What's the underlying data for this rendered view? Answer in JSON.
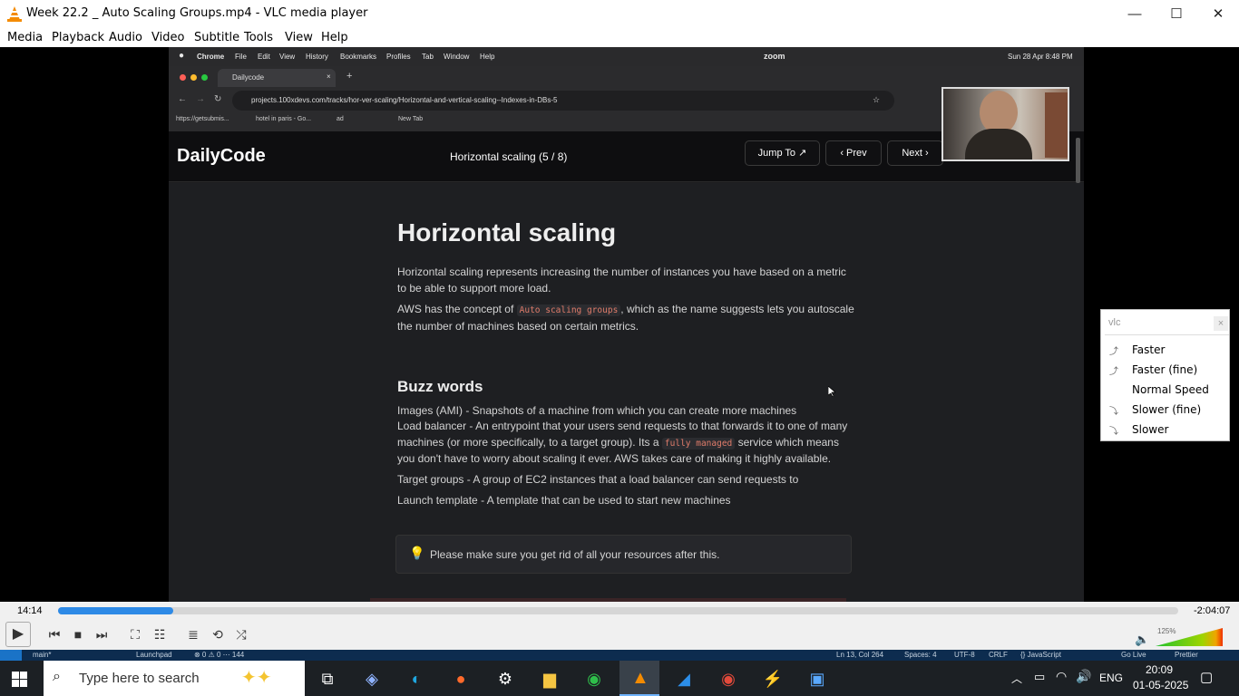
{
  "window": {
    "title": "Week 22.2 _ Auto Scaling Groups.mp4 - VLC media player",
    "minimize": "—",
    "maximize": "☐",
    "close": "✕"
  },
  "menu": [
    "Media",
    "Playback",
    "Audio",
    "Video",
    "Subtitle",
    "Tools",
    "View",
    "Help"
  ],
  "mac_menubar": {
    "apple": "",
    "app": "Chrome",
    "items": [
      "File",
      "Edit",
      "View",
      "History",
      "Bookmarks",
      "Profiles",
      "Tab",
      "Window",
      "Help"
    ],
    "zoom": "zoom",
    "clock": "Sun 28 Apr  8:48 PM"
  },
  "browser": {
    "tab_title": "Dailycode",
    "url": "projects.100xdevs.com/tracks/hor-ver-scaling/Horizontal-and-vertical-scaling--Indexes-in-DBs-5",
    "bookmarks": [
      "https://getsubmis...",
      "hotel in paris - Go...",
      "ad",
      "New Tab"
    ]
  },
  "site": {
    "logo": "DailyCode",
    "page_title": "Horizontal scaling (5 / 8)",
    "jump_to": "Jump To",
    "jump_icon": "↗",
    "prev": "Prev",
    "prev_icon": "‹",
    "next": "Next",
    "next_icon": "›"
  },
  "article": {
    "h1": "Horizontal scaling",
    "p1": "Horizontal scaling represents increasing the number of instances you have based on a metric to be able to support more load.",
    "p2_before": "AWS has the concept of ",
    "p2_code": "Auto scaling groups",
    "p2_after": ", which as the name suggests lets you autoscale the number of machines based on certain metrics.",
    "h2": "Buzz words",
    "b1": "Images (AMI) - Snapshots of a machine from which you can create more machines",
    "b2_before": "Load balancer - An entrypoint that your users send requests to that forwards it to one of many machines (or more specifically, to a target group). Its a ",
    "b2_code": "fully managed",
    "b2_after": " service which means you don't have to worry about scaling it ever. AWS takes care of making it highly available.",
    "b3": "Target groups - A group of EC2 instances that a load balancer can send requests to",
    "b4": "Launch template - A template that can be used to start new machines",
    "callout": "Please make sure you get rid of all your resources after this."
  },
  "popup": {
    "input_value": "vlc",
    "close": "×",
    "items": [
      "Faster",
      "Faster (fine)",
      "Normal Speed",
      "Slower (fine)",
      "Slower"
    ]
  },
  "player": {
    "elapsed": "14:14",
    "remaining": "-2:04:07",
    "progress": 0.1025,
    "volume_label": "125%",
    "volume": 1.0
  },
  "vscode_strip": {
    "left": "main*",
    "launchpad": "Launchpad",
    "errors": "⊗ 0 ⚠ 0 ⋯ 144",
    "position": "Ln 13, Col 264",
    "spaces": "Spaces: 4",
    "encoding": "UTF-8",
    "eol": "CRLF",
    "language": "{} JavaScript",
    "golive": "Go Live",
    "prettier": "Prettier"
  },
  "taskbar": {
    "search_placeholder": "Type here to search",
    "lang": "ENG",
    "time": "20:09",
    "date": "01-05-2025"
  }
}
